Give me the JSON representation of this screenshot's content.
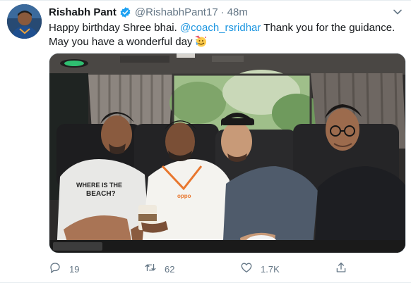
{
  "tweet": {
    "author_name": "Rishabh Pant",
    "author_handle": "@RishabhPant17",
    "separator": "·",
    "timestamp": "48m",
    "text_line1_before": "Happy birthday Shree bhai.  ",
    "mention": "@coach_rsridhar",
    "text_line1_after": " Thank you for the guidance.",
    "text_line2": "May you have a wonderful day",
    "emoji": "party-face-emoji",
    "media_icon": "photo-of-four-men-in-vehicle"
  },
  "actions": {
    "reply_count": "19",
    "retweet_count": "62",
    "like_count": "1.7K",
    "reply_icon": "reply-icon",
    "retweet_icon": "retweet-icon",
    "like_icon": "heart-icon",
    "share_icon": "share-icon"
  },
  "colors": {
    "link": "#1b95e0",
    "secondary_text": "#657786",
    "primary_text": "#14171a",
    "verified": "#1da1f2"
  }
}
